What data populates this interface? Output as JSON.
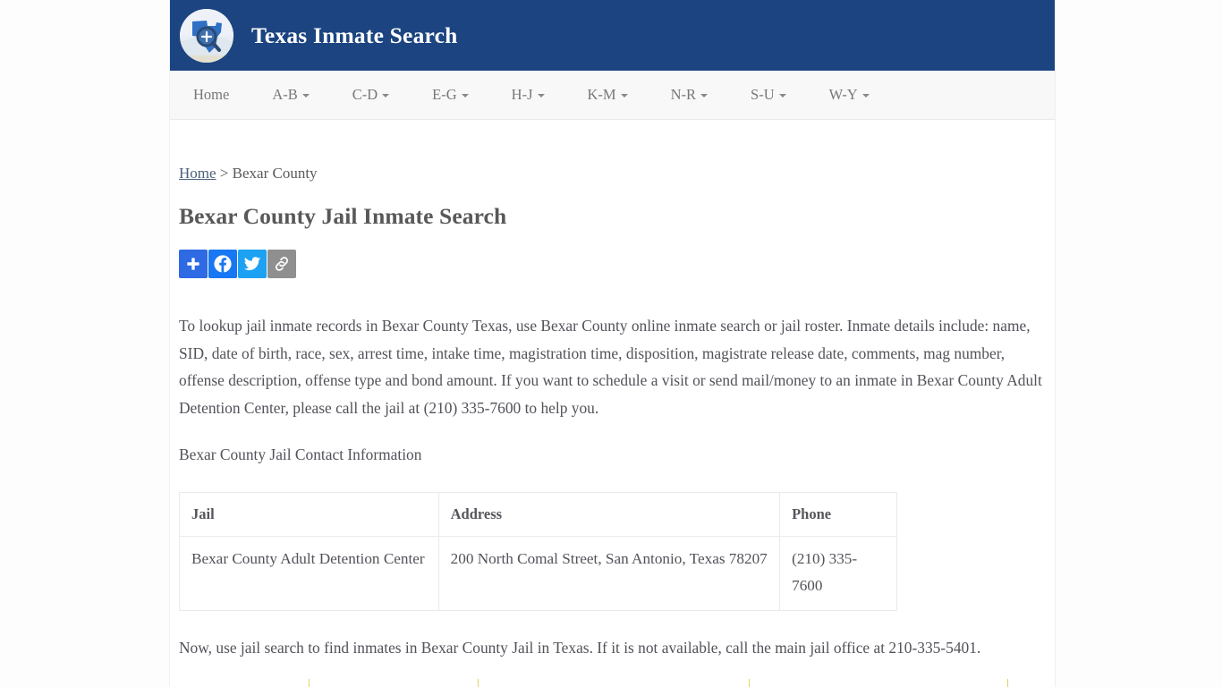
{
  "header": {
    "site_title": "Texas Inmate Search",
    "logo_name": "texas-magnifier-logo",
    "bg_color": "#1b4480"
  },
  "nav": {
    "items": [
      {
        "label": "Home",
        "has_caret": false
      },
      {
        "label": "A-B",
        "has_caret": true
      },
      {
        "label": "C-D",
        "has_caret": true
      },
      {
        "label": "E-G",
        "has_caret": true
      },
      {
        "label": "H-J",
        "has_caret": true
      },
      {
        "label": "K-M",
        "has_caret": true
      },
      {
        "label": "N-R",
        "has_caret": true
      },
      {
        "label": "S-U",
        "has_caret": true
      },
      {
        "label": "W-Y",
        "has_caret": true
      }
    ]
  },
  "breadcrumb": {
    "home_label": "Home",
    "separator": " > ",
    "current": "Bexar County"
  },
  "page_title": "Bexar County Jail Inmate Search",
  "share": {
    "buttons": [
      {
        "name": "addthis-share-button",
        "label": "Share",
        "color": "#2d6ae3"
      },
      {
        "name": "facebook-share-button",
        "label": "Facebook",
        "color": "#1877f2"
      },
      {
        "name": "twitter-share-button",
        "label": "Twitter",
        "color": "#1da1f2"
      },
      {
        "name": "copy-link-button",
        "label": "Copy Link",
        "color": "#8f8f8f"
      }
    ]
  },
  "intro_paragraph": "To lookup jail inmate records in Bexar County Texas, use Bexar County online inmate search or jail roster. Inmate details include: name, SID, date of birth, race, sex, arrest time, intake time, magistration time, disposition, magistrate release date, comments, mag number, offense description, offense type and bond amount. If you want to schedule a visit or send mail/money to an inmate in Bexar County Adult Detention Center, please call the jail at (210) 335-7600 to help you.",
  "contact_heading": "Bexar County Jail Contact Information",
  "contact_table": {
    "columns": [
      "Jail",
      "Address",
      "Phone"
    ],
    "rows": [
      {
        "jail": "Bexar County Adult Detention Center",
        "address": "200 North Comal Street, San Antonio, Texas 78207",
        "phone": "(210) 335-7600"
      }
    ]
  },
  "bottom_paragraph": "Now, use jail search to find inmates in Bexar County Jail in Texas. If it is not available, call the main jail office at 210-335-5401."
}
